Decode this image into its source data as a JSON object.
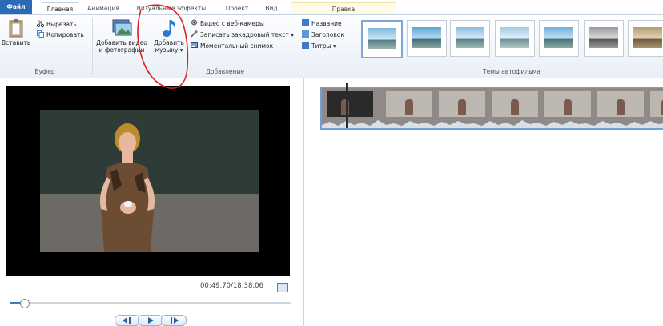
{
  "tabs": {
    "file": "Файл",
    "home": "Главная",
    "animation": "Анимация",
    "visual_effects": "Визуальные эффекты",
    "project": "Проект",
    "view": "Вид",
    "edit": "Правка"
  },
  "ribbon": {
    "clipboard": {
      "paste": "Вставить",
      "cut": "Вырезать",
      "copy": "Копировать",
      "label": "Буфер"
    },
    "add": {
      "add_video_line1": "Добавить видео",
      "add_video_line2": "и фотографии",
      "add_music_line1": "Добавить",
      "add_music_line2": "музыку ▾",
      "webcam": "Видео с веб-камеры",
      "narration": "Записать закадровый текст ▾",
      "snapshot": "Моментальный снимок",
      "title": "Название",
      "caption": "Заголовок",
      "credits": "Титры ▾",
      "label": "Добавление"
    },
    "themes": {
      "label": "Темы автофильма"
    }
  },
  "preview": {
    "timecode": "00:49,70/18:38,06",
    "seek_fraction": 0.05
  },
  "colors": {
    "accent": "#2a6ab7",
    "annotation": "#e02020"
  }
}
